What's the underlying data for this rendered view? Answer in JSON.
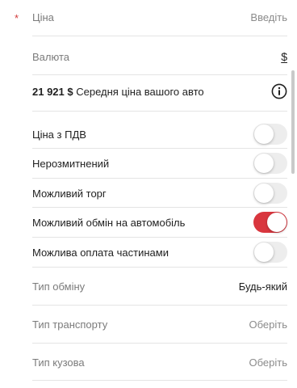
{
  "price": {
    "required_mark": "*",
    "label": "Ціна",
    "placeholder": "Введіть"
  },
  "currency": {
    "label": "Валюта",
    "value": "$"
  },
  "average": {
    "price": "21 921 $",
    "text": "Середня ціна вашого авто",
    "icon": "info-icon"
  },
  "toggles": [
    {
      "label": "Ціна з ПДВ",
      "on": false
    },
    {
      "label": "Нерозмитнений",
      "on": false
    },
    {
      "label": "Можливий торг",
      "on": false
    },
    {
      "label": "Можливий обмін на автомобіль",
      "on": true
    },
    {
      "label": "Можлива оплата частинами",
      "on": false
    }
  ],
  "selects": [
    {
      "label": "Тип обміну",
      "value": "Будь-який"
    },
    {
      "label": "Тип транспорту",
      "value": "Оберіть"
    },
    {
      "label": "Тип кузова",
      "value": "Оберіть"
    }
  ],
  "colors": {
    "accent": "#d9363e",
    "toggle_off": "#ededed",
    "divider": "#e4e4e4",
    "muted_text": "#7b7b7b"
  }
}
